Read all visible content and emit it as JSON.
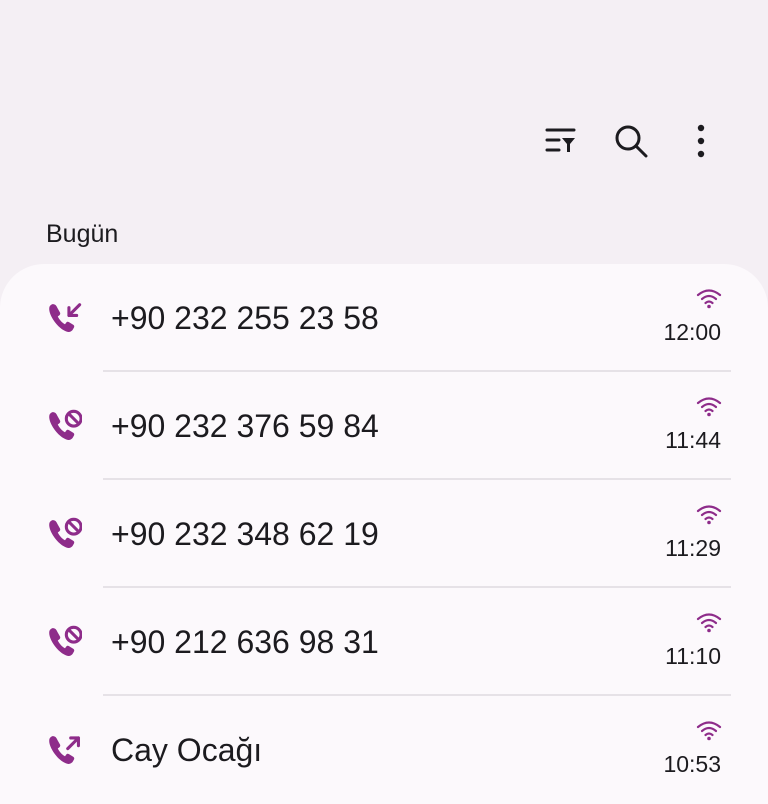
{
  "toolbar": {
    "filter_icon": "filter-list-icon",
    "search_icon": "search-icon",
    "more_icon": "more-vert-icon"
  },
  "section": {
    "title": "Bugün"
  },
  "colors": {
    "accent": "#8e2c8a",
    "background": "#f4eff4",
    "card": "#fcf9fc"
  },
  "calls": [
    {
      "name": "+90 232 255 23 58",
      "time": "12:00",
      "type": "incoming"
    },
    {
      "name": "+90 232 376 59 84",
      "time": "11:44",
      "type": "blocked"
    },
    {
      "name": "+90 232 348 62 19",
      "time": "11:29",
      "type": "blocked"
    },
    {
      "name": "+90 212 636 98 31",
      "time": "11:10",
      "type": "blocked"
    },
    {
      "name": "Cay Ocağı",
      "time": "10:53",
      "type": "outgoing"
    }
  ]
}
